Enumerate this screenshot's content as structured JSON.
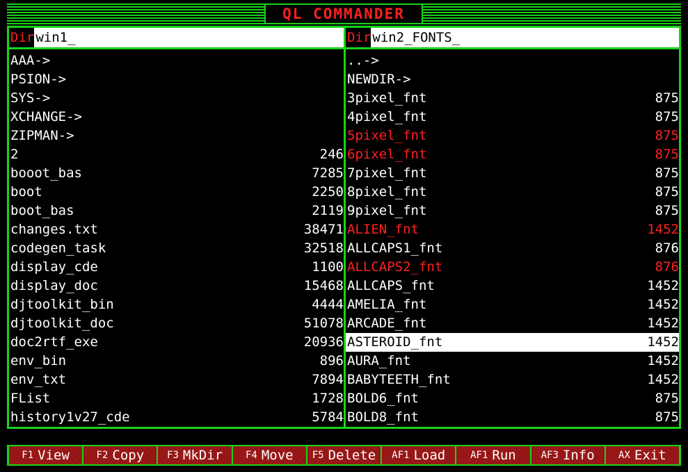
{
  "title": "QL COMMANDER",
  "left": {
    "dir_label": "Dir",
    "dir_path": "win1_",
    "entries": [
      {
        "name": "AAA->",
        "size": ""
      },
      {
        "name": "PSION->",
        "size": ""
      },
      {
        "name": "SYS->",
        "size": ""
      },
      {
        "name": "XCHANGE->",
        "size": ""
      },
      {
        "name": "ZIPMAN->",
        "size": ""
      },
      {
        "name": "2",
        "size": "246"
      },
      {
        "name": "booot_bas",
        "size": "7285"
      },
      {
        "name": "boot",
        "size": "2250"
      },
      {
        "name": "boot_bas",
        "size": "2119"
      },
      {
        "name": "changes.txt",
        "size": "38471"
      },
      {
        "name": "codegen_task",
        "size": "32518"
      },
      {
        "name": "display_cde",
        "size": "1100"
      },
      {
        "name": "display_doc",
        "size": "15468"
      },
      {
        "name": "djtoolkit_bin",
        "size": "4444"
      },
      {
        "name": "djtoolkit_doc",
        "size": "51078"
      },
      {
        "name": "doc2rtf_exe",
        "size": "20936"
      },
      {
        "name": "env_bin",
        "size": "896"
      },
      {
        "name": "env_txt",
        "size": "7894"
      },
      {
        "name": "FList",
        "size": "1728"
      },
      {
        "name": "history1v27_cde",
        "size": "5784"
      }
    ]
  },
  "right": {
    "dir_label": "Dir",
    "dir_path": "win2_FONTS_",
    "entries": [
      {
        "name": "..->",
        "size": "",
        "state": "normal"
      },
      {
        "name": "NEWDIR->",
        "size": "",
        "state": "normal"
      },
      {
        "name": "3pixel_fnt",
        "size": "875",
        "state": "normal"
      },
      {
        "name": "4pixel_fnt",
        "size": "875",
        "state": "normal"
      },
      {
        "name": "5pixel_fnt",
        "size": "875",
        "state": "tagged"
      },
      {
        "name": "6pixel_fnt",
        "size": "875",
        "state": "tagged"
      },
      {
        "name": "7pixel_fnt",
        "size": "875",
        "state": "normal"
      },
      {
        "name": "8pixel_fnt",
        "size": "875",
        "state": "normal"
      },
      {
        "name": "9pixel_fnt",
        "size": "875",
        "state": "normal"
      },
      {
        "name": "ALIEN_fnt",
        "size": "1452",
        "state": "tagged"
      },
      {
        "name": "ALLCAPS1_fnt",
        "size": "876",
        "state": "normal"
      },
      {
        "name": "ALLCAPS2_fnt",
        "size": "876",
        "state": "tagged"
      },
      {
        "name": "ALLCAPS_fnt",
        "size": "1452",
        "state": "normal"
      },
      {
        "name": "AMELIA_fnt",
        "size": "1452",
        "state": "normal"
      },
      {
        "name": "ARCADE_fnt",
        "size": "1452",
        "state": "normal"
      },
      {
        "name": "ASTEROID_fnt",
        "size": "1452",
        "state": "selected"
      },
      {
        "name": "AURA_fnt",
        "size": "1452",
        "state": "normal"
      },
      {
        "name": "BABYTEETH_fnt",
        "size": "1452",
        "state": "normal"
      },
      {
        "name": "BOLD6_fnt",
        "size": "875",
        "state": "normal"
      },
      {
        "name": "BOLD8_fnt",
        "size": "875",
        "state": "normal"
      }
    ]
  },
  "fkeys": [
    {
      "key": "F1",
      "label": "View"
    },
    {
      "key": "F2",
      "label": "Copy"
    },
    {
      "key": "F3",
      "label": "MkDir"
    },
    {
      "key": "F4",
      "label": "Move"
    },
    {
      "key": "F5",
      "label": "Delete"
    },
    {
      "key": "AF1",
      "label": "Load"
    },
    {
      "key": "AF1",
      "label": "Run"
    },
    {
      "key": "AF3",
      "label": "Info"
    },
    {
      "key": "AX",
      "label": "Exit"
    }
  ],
  "colors": {
    "frame": "#18d418",
    "tagged": "#ff2020",
    "fkey_bg": "#8a1212"
  }
}
